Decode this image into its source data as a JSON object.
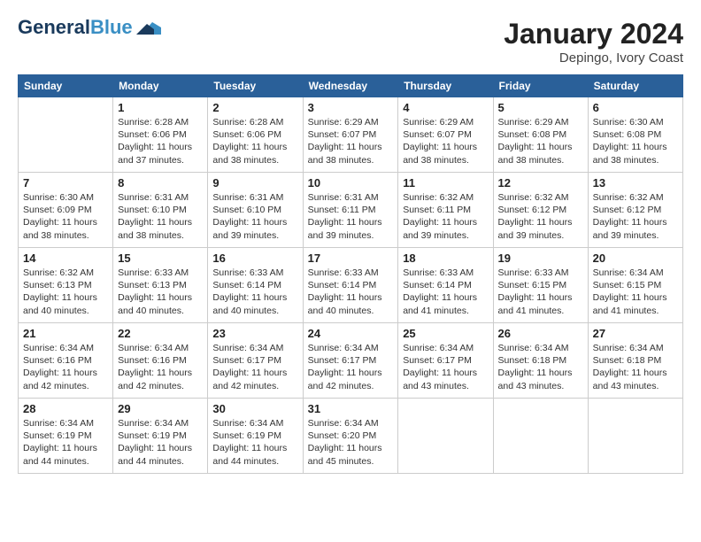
{
  "header": {
    "logo_general": "General",
    "logo_blue": "Blue",
    "month": "January 2024",
    "location": "Depingo, Ivory Coast"
  },
  "days_of_week": [
    "Sunday",
    "Monday",
    "Tuesday",
    "Wednesday",
    "Thursday",
    "Friday",
    "Saturday"
  ],
  "weeks": [
    [
      {
        "day": "",
        "info": ""
      },
      {
        "day": "1",
        "info": "Sunrise: 6:28 AM\nSunset: 6:06 PM\nDaylight: 11 hours\nand 37 minutes."
      },
      {
        "day": "2",
        "info": "Sunrise: 6:28 AM\nSunset: 6:06 PM\nDaylight: 11 hours\nand 38 minutes."
      },
      {
        "day": "3",
        "info": "Sunrise: 6:29 AM\nSunset: 6:07 PM\nDaylight: 11 hours\nand 38 minutes."
      },
      {
        "day": "4",
        "info": "Sunrise: 6:29 AM\nSunset: 6:07 PM\nDaylight: 11 hours\nand 38 minutes."
      },
      {
        "day": "5",
        "info": "Sunrise: 6:29 AM\nSunset: 6:08 PM\nDaylight: 11 hours\nand 38 minutes."
      },
      {
        "day": "6",
        "info": "Sunrise: 6:30 AM\nSunset: 6:08 PM\nDaylight: 11 hours\nand 38 minutes."
      }
    ],
    [
      {
        "day": "7",
        "info": "Sunrise: 6:30 AM\nSunset: 6:09 PM\nDaylight: 11 hours\nand 38 minutes."
      },
      {
        "day": "8",
        "info": "Sunrise: 6:31 AM\nSunset: 6:10 PM\nDaylight: 11 hours\nand 38 minutes."
      },
      {
        "day": "9",
        "info": "Sunrise: 6:31 AM\nSunset: 6:10 PM\nDaylight: 11 hours\nand 39 minutes."
      },
      {
        "day": "10",
        "info": "Sunrise: 6:31 AM\nSunset: 6:11 PM\nDaylight: 11 hours\nand 39 minutes."
      },
      {
        "day": "11",
        "info": "Sunrise: 6:32 AM\nSunset: 6:11 PM\nDaylight: 11 hours\nand 39 minutes."
      },
      {
        "day": "12",
        "info": "Sunrise: 6:32 AM\nSunset: 6:12 PM\nDaylight: 11 hours\nand 39 minutes."
      },
      {
        "day": "13",
        "info": "Sunrise: 6:32 AM\nSunset: 6:12 PM\nDaylight: 11 hours\nand 39 minutes."
      }
    ],
    [
      {
        "day": "14",
        "info": "Sunrise: 6:32 AM\nSunset: 6:13 PM\nDaylight: 11 hours\nand 40 minutes."
      },
      {
        "day": "15",
        "info": "Sunrise: 6:33 AM\nSunset: 6:13 PM\nDaylight: 11 hours\nand 40 minutes."
      },
      {
        "day": "16",
        "info": "Sunrise: 6:33 AM\nSunset: 6:14 PM\nDaylight: 11 hours\nand 40 minutes."
      },
      {
        "day": "17",
        "info": "Sunrise: 6:33 AM\nSunset: 6:14 PM\nDaylight: 11 hours\nand 40 minutes."
      },
      {
        "day": "18",
        "info": "Sunrise: 6:33 AM\nSunset: 6:14 PM\nDaylight: 11 hours\nand 41 minutes."
      },
      {
        "day": "19",
        "info": "Sunrise: 6:33 AM\nSunset: 6:15 PM\nDaylight: 11 hours\nand 41 minutes."
      },
      {
        "day": "20",
        "info": "Sunrise: 6:34 AM\nSunset: 6:15 PM\nDaylight: 11 hours\nand 41 minutes."
      }
    ],
    [
      {
        "day": "21",
        "info": "Sunrise: 6:34 AM\nSunset: 6:16 PM\nDaylight: 11 hours\nand 42 minutes."
      },
      {
        "day": "22",
        "info": "Sunrise: 6:34 AM\nSunset: 6:16 PM\nDaylight: 11 hours\nand 42 minutes."
      },
      {
        "day": "23",
        "info": "Sunrise: 6:34 AM\nSunset: 6:17 PM\nDaylight: 11 hours\nand 42 minutes."
      },
      {
        "day": "24",
        "info": "Sunrise: 6:34 AM\nSunset: 6:17 PM\nDaylight: 11 hours\nand 42 minutes."
      },
      {
        "day": "25",
        "info": "Sunrise: 6:34 AM\nSunset: 6:17 PM\nDaylight: 11 hours\nand 43 minutes."
      },
      {
        "day": "26",
        "info": "Sunrise: 6:34 AM\nSunset: 6:18 PM\nDaylight: 11 hours\nand 43 minutes."
      },
      {
        "day": "27",
        "info": "Sunrise: 6:34 AM\nSunset: 6:18 PM\nDaylight: 11 hours\nand 43 minutes."
      }
    ],
    [
      {
        "day": "28",
        "info": "Sunrise: 6:34 AM\nSunset: 6:19 PM\nDaylight: 11 hours\nand 44 minutes."
      },
      {
        "day": "29",
        "info": "Sunrise: 6:34 AM\nSunset: 6:19 PM\nDaylight: 11 hours\nand 44 minutes."
      },
      {
        "day": "30",
        "info": "Sunrise: 6:34 AM\nSunset: 6:19 PM\nDaylight: 11 hours\nand 44 minutes."
      },
      {
        "day": "31",
        "info": "Sunrise: 6:34 AM\nSunset: 6:20 PM\nDaylight: 11 hours\nand 45 minutes."
      },
      {
        "day": "",
        "info": ""
      },
      {
        "day": "",
        "info": ""
      },
      {
        "day": "",
        "info": ""
      }
    ]
  ]
}
